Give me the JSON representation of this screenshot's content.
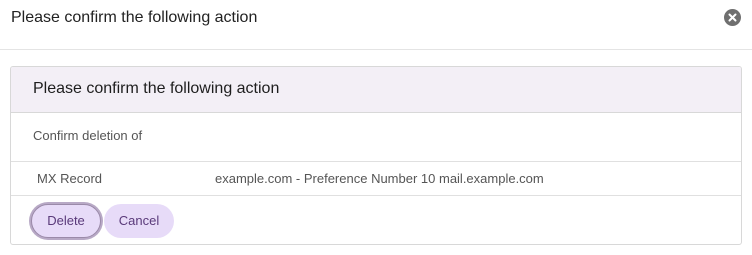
{
  "modal": {
    "title": "Please confirm the following action",
    "close_icon": "close-icon"
  },
  "panel": {
    "heading": "Please confirm the following action",
    "confirm_text": "Confirm deletion of",
    "record": {
      "type": "MX Record",
      "value": "example.com - Preference Number 10 mail.example.com"
    }
  },
  "actions": {
    "delete_label": "Delete",
    "cancel_label": "Cancel"
  },
  "colors": {
    "panel_heading_bg": "#f3eff6",
    "button_bg": "#e7dbf8",
    "button_text": "#5a3a7a"
  }
}
